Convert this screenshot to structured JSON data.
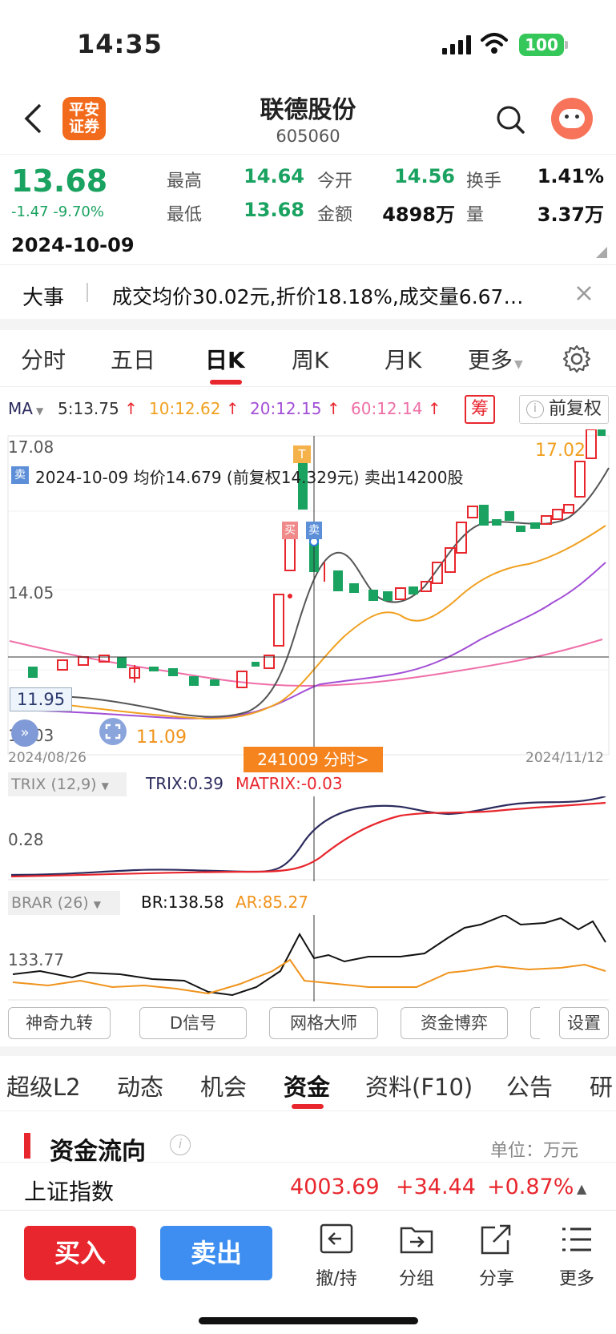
{
  "status": {
    "time": "14:35",
    "battery": "100"
  },
  "header": {
    "broker_logo": "平安证券",
    "name": "联德股份",
    "code": "605060",
    "back_icon": "chevron-left-icon",
    "search_icon": "search-icon",
    "avatar_icon": "avatar-icon"
  },
  "quote": {
    "price": "13.68",
    "change": "-1.47 -9.70%",
    "date": "2024-10-09",
    "high_label": "最高",
    "high": "14.64",
    "open_label": "今开",
    "open": "14.56",
    "turnover_label": "换手",
    "turnover": "1.41%",
    "low_label": "最低",
    "low": "13.68",
    "amount_label": "金额",
    "amount": "4898万",
    "volume_label": "量",
    "volume": "3.37万"
  },
  "news": {
    "tag": "大事",
    "text": "成交均价30.02元,折价18.18%,成交量6.67…"
  },
  "tabs": [
    "分时",
    "五日",
    "日K",
    "周K",
    "月K",
    "更多"
  ],
  "ma": {
    "label": "MA",
    "ma5": "5:13.75",
    "ma10": "10:12.62",
    "ma20": "20:12.15",
    "ma60": "60:12.14",
    "chip_btn": "筹",
    "adjust_btn": "前复权"
  },
  "kline": {
    "y_top": "17.08",
    "y_mid": "14.05",
    "y_bottom": "11.03",
    "cross_price": "11.95",
    "low_mark": "11.09",
    "high_mark": "17.02",
    "date_start": "2024/08/26",
    "date_end": "2024/11/12",
    "trade_tag": "卖",
    "trade_note": "2024-10-09 均价14.679 (前复权14.329元) 卖出14200股",
    "cross_date_btn": "241009 分时>",
    "t_mark": "T",
    "buy_mark": "买",
    "sell_mark": "卖"
  },
  "trix": {
    "label": "TRIX (12,9)",
    "trix": "TRIX:0.39",
    "matrix": "MATRIX:-0.03",
    "y_label": "0.28"
  },
  "brar": {
    "label": "BRAR (26)",
    "br": "BR:138.58",
    "ar": "AR:85.27",
    "y_label": "133.77"
  },
  "tools": [
    "神奇九转",
    "D信号",
    "网格大师",
    "资金博弈",
    "设置"
  ],
  "tabs2": [
    "超级L2",
    "动态",
    "机会",
    "资金",
    "资料(F10)",
    "公告",
    "研"
  ],
  "fund": {
    "title": "资金流向",
    "unit": "单位：万元"
  },
  "index": {
    "name": "上证指数",
    "value": "4003.69",
    "change": "+34.44",
    "pct": "+0.87%"
  },
  "footer": {
    "buy": "买入",
    "sell": "卖出",
    "cancel": "撤/持",
    "group": "分组",
    "share": "分享",
    "more": "更多"
  },
  "colors": {
    "up": "#e8262d",
    "down": "#1aa260",
    "ma5": "#333333",
    "ma10": "#f0a020",
    "ma20": "#a24fd6",
    "ma60": "#ee6fa6"
  }
}
